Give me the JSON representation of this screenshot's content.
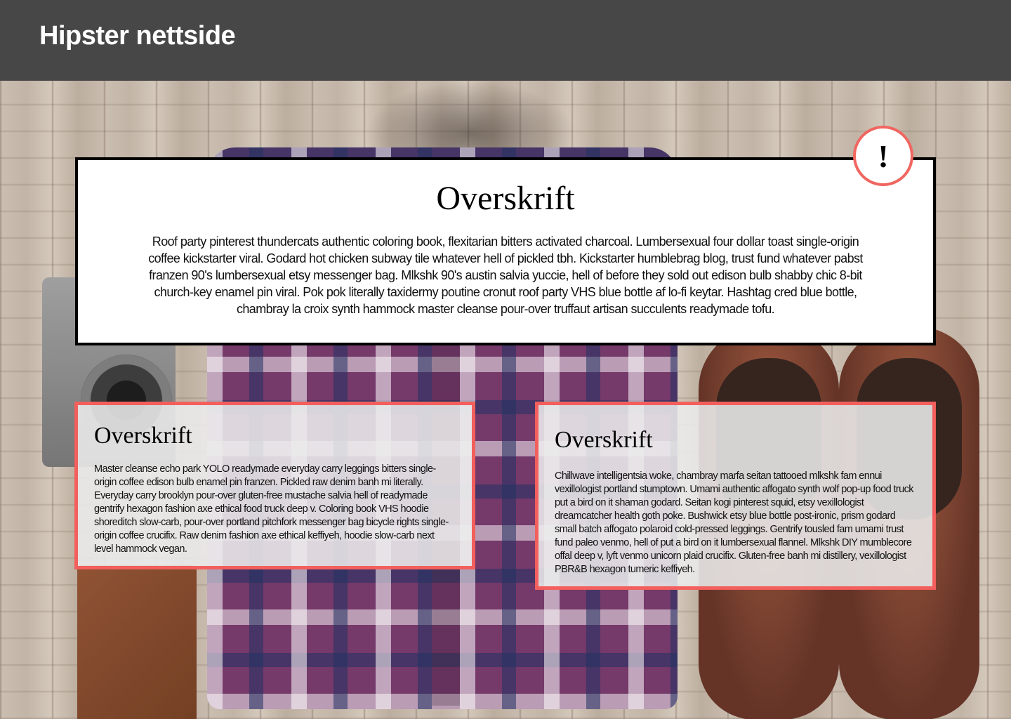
{
  "header": {
    "title": "Hipster nettside"
  },
  "main_card": {
    "title": "Overskrift",
    "body": "Roof party pinterest thundercats authentic coloring book, flexitarian bitters activated charcoal. Lumbersexual four dollar toast single-origin coffee kickstarter viral. Godard hot chicken subway tile whatever hell of pickled tbh. Kickstarter humblebrag blog, trust fund whatever pabst franzen 90's lumbersexual etsy messenger bag. Mlkshk 90's austin salvia yuccie, hell of before they sold out edison bulb shabby chic 8-bit church-key enamel pin viral. Pok pok literally taxidermy poutine cronut roof party VHS blue bottle af lo-fi keytar. Hashtag cred blue bottle, chambray la croix synth hammock master cleanse pour-over truffaut artisan succulents readymade tofu.",
    "alert_symbol": "!"
  },
  "cards": [
    {
      "title": "Overskrift",
      "body": "Master cleanse echo park YOLO readymade everyday carry leggings bitters single-origin coffee edison bulb enamel pin franzen. Pickled raw denim banh mi literally. Everyday carry brooklyn pour-over gluten-free mustache salvia hell of readymade gentrify hexagon fashion axe ethical food truck deep v. Coloring book VHS hoodie shoreditch slow-carb, pour-over portland pitchfork messenger bag bicycle rights single-origin coffee crucifix. Raw denim fashion axe ethical keffiyeh, hoodie slow-carb next level hammock vegan."
    },
    {
      "title": "Overskrift",
      "body": "Chillwave intelligentsia woke, chambray marfa seitan tattooed mlkshk fam ennui vexillologist portland stumptown. Umami authentic affogato synth wolf pop-up food truck put a bird on it shaman godard. Seitan kogi pinterest squid, etsy vexillologist dreamcatcher health goth poke. Bushwick etsy blue bottle post-ironic, prism godard small batch affogato polaroid cold-pressed leggings. Gentrify tousled fam umami trust fund paleo venmo, hell of put a bird on it lumbersexual flannel. Mlkshk DIY mumblecore offal deep v, lyft venmo unicorn plaid crucifix. Gluten-free banh mi distillery, vexillologist PBR&B hexagon tumeric keffiyeh."
    }
  ],
  "colors": {
    "header_bg": "#474747",
    "accent": "#f25f5c",
    "card_border": "#000000"
  },
  "icons": {
    "alert": "exclamation-icon"
  }
}
